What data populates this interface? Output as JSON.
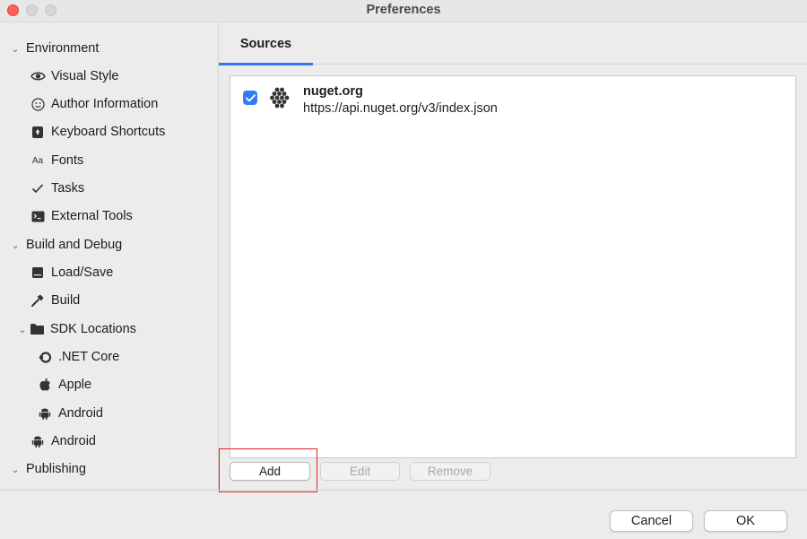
{
  "window": {
    "title": "Preferences"
  },
  "sidebar": {
    "items": [
      {
        "label": "Environment",
        "icon": "chevron-down-icon"
      },
      {
        "label": "Visual Style",
        "icon": "eye-icon"
      },
      {
        "label": "Author Information",
        "icon": "smiley-icon"
      },
      {
        "label": "Keyboard Shortcuts",
        "icon": "keyboard-icon"
      },
      {
        "label": "Fonts",
        "icon": "fonts-icon",
        "glyph": "Aa"
      },
      {
        "label": "Tasks",
        "icon": "checkmark-icon"
      },
      {
        "label": "External Tools",
        "icon": "terminal-icon"
      },
      {
        "label": "Build and Debug",
        "icon": "chevron-down-icon"
      },
      {
        "label": "Load/Save",
        "icon": "disk-icon"
      },
      {
        "label": "Build",
        "icon": "hammer-icon"
      },
      {
        "label": "SDK Locations",
        "icon": "folder-icon"
      },
      {
        "label": ".NET Core",
        "icon": "dotnet-icon"
      },
      {
        "label": "Apple",
        "icon": "apple-icon"
      },
      {
        "label": "Android",
        "icon": "android-icon"
      },
      {
        "label": "Android",
        "icon": "android-icon"
      },
      {
        "label": "Publishing",
        "icon": "chevron-down-icon"
      }
    ]
  },
  "content": {
    "tab_label": "Sources",
    "sources": [
      {
        "name": "nuget.org",
        "url": "https://api.nuget.org/v3/index.json",
        "checked": true
      }
    ],
    "buttons": {
      "add": "Add",
      "edit": "Edit",
      "remove": "Remove"
    }
  },
  "footer": {
    "cancel": "Cancel",
    "ok": "OK"
  },
  "colors": {
    "accent": "#3478f6",
    "highlight": "#e02020"
  }
}
